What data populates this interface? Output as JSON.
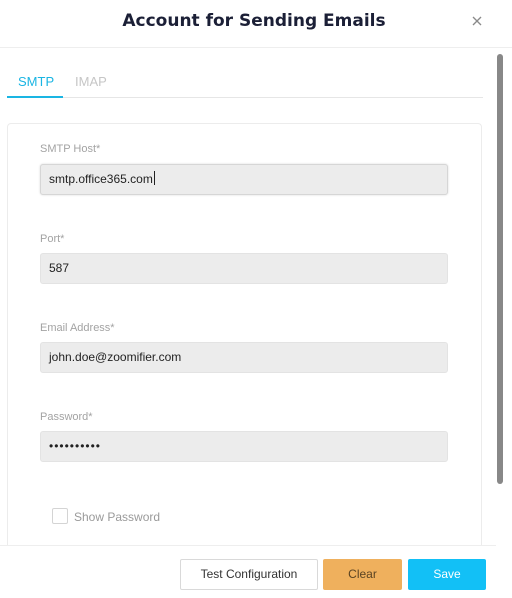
{
  "dialog": {
    "title": "Account for Sending Emails",
    "close_icon": "close-icon"
  },
  "tabs": [
    {
      "label": "SMTP",
      "active": true
    },
    {
      "label": "IMAP",
      "active": false
    }
  ],
  "form": {
    "smtp_host": {
      "label": "SMTP Host*",
      "value": "smtp.office365.com"
    },
    "port": {
      "label": "Port*",
      "value": "587"
    },
    "email": {
      "label": "Email Address*",
      "value": "john.doe@zoomifier.com"
    },
    "password": {
      "label": "Password*",
      "value": "••••••••••"
    },
    "show_password": {
      "label": "Show Password",
      "checked": false
    }
  },
  "footer": {
    "test_label": "Test Configuration",
    "clear_label": "Clear",
    "save_label": "Save"
  },
  "colors": {
    "accent": "#1ab5e3",
    "clear": "#efb05d",
    "save": "#12c0f6",
    "title": "#1b1f36"
  }
}
